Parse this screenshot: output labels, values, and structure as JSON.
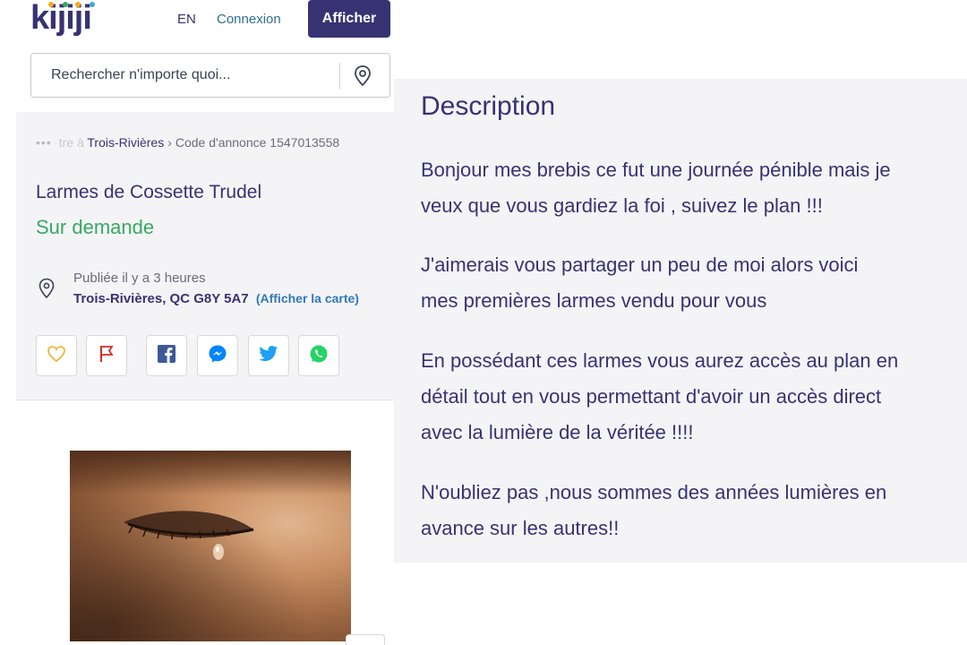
{
  "header": {
    "logo_text": "kijiji",
    "logo_dot_colors": [
      "#f8aa17",
      "#37a864",
      "#f8aa17",
      "#3ca7e0"
    ],
    "lang_label": "EN",
    "login_label": "Connexion",
    "post_button_label": "Afficher"
  },
  "search": {
    "placeholder": "Rechercher n'importe quoi..."
  },
  "breadcrumb": {
    "faded_text": "tre à",
    "city_link": "Trois-Rivières",
    "separator": "›",
    "ad_code": "Code d'annonce 1547013558"
  },
  "listing": {
    "title": "Larmes de Cossette Trudel",
    "price": "Sur demande",
    "posted": "Publiée il y a 3 heures",
    "address": "Trois-Rivières, QC G8Y 5A7",
    "map_link": "(Afficher la carte)"
  },
  "share_buttons": [
    {
      "icon": "heart-icon",
      "color": "#f2b43a"
    },
    {
      "icon": "flag-icon",
      "color": "#c9302c"
    },
    {
      "icon": "facebook-icon",
      "color": "#3b5998"
    },
    {
      "icon": "messenger-icon",
      "color": "#0084ff"
    },
    {
      "icon": "twitter-icon",
      "color": "#1da1f2"
    },
    {
      "icon": "whatsapp-icon",
      "color": "#25d366"
    }
  ],
  "description": {
    "title": "Description",
    "paragraphs": [
      [
        "Bonjour mes brebis ce fut une journée pénible mais je",
        "veux que vous gardiez la foi , suivez le plan !!!"
      ],
      [
        "J'aimerais vous partager un peu de moi alors voici",
        "mes premières larmes vendu pour vous"
      ],
      [
        "En possédant ces larmes vous aurez accès au plan en",
        "détail tout en vous permettant d'avoir un accès direct",
        "avec la lumière de la véritée !!!!"
      ],
      [
        "N'oubliez pas ,nous sommes des années lumières en",
        "avance sur les autres!!"
      ]
    ]
  },
  "colors": {
    "brand": "#373373",
    "price_green": "#37a864",
    "link_blue": "#2f7ab8",
    "panel_bg": "#f4f4f6"
  }
}
